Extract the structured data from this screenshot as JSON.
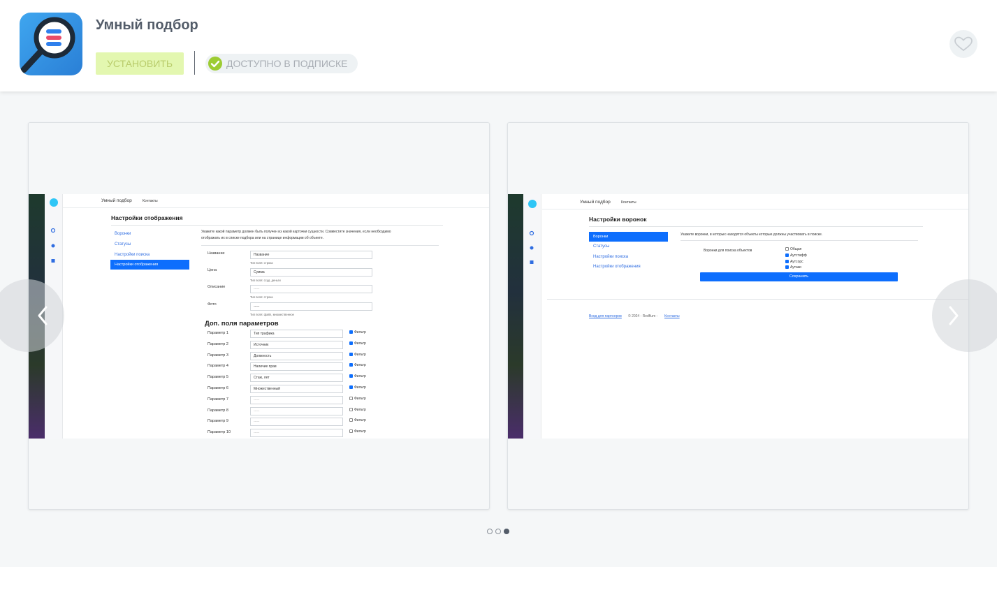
{
  "app": {
    "title": "Умный подбор",
    "install_label": "УСТАНОВИТЬ",
    "subscription_label": "ДОСТУПНО В ПОДПИСКЕ"
  },
  "slide1": {
    "topbar": {
      "brand": "Умный подбор",
      "link": "Контакты"
    },
    "page_title": "Настройки отображения",
    "nav": [
      "Воронки",
      "Статусы",
      "Настройки поиска",
      "Настройки отображения"
    ],
    "hint_line1": "Укажите какой параметр должен быть получен из какой карточки сущности. Совместите значения, если необходимо",
    "hint_line2": "отображать их в списке подбора или на странице информации об объекте.",
    "fields": [
      {
        "label": "Название",
        "value": "Название",
        "note": "Тип поля: строка"
      },
      {
        "label": "Цена",
        "value": "Сумма",
        "note": "Тип поля: ссуд. деньги"
      },
      {
        "label": "Описание",
        "value": "-----",
        "note": "Тип поля: строка"
      },
      {
        "label": "Фото",
        "value": "-----",
        "note": "Тип поля: файл, множественное"
      }
    ],
    "extra_title": "Доп. поля параметров",
    "filter_label": "Фильтр",
    "params": [
      {
        "label": "Параметр 1",
        "value": "Тип трафика"
      },
      {
        "label": "Параметр 2",
        "value": "Источник"
      },
      {
        "label": "Параметр 3",
        "value": "Должность"
      },
      {
        "label": "Параметр 4",
        "value": "Наличие прав"
      },
      {
        "label": "Параметр 5",
        "value": "Стаж, лет"
      },
      {
        "label": "Параметр 6",
        "value": "Множественный"
      },
      {
        "label": "Параметр 7",
        "value": "-----"
      },
      {
        "label": "Параметр 8",
        "value": "-----"
      },
      {
        "label": "Параметр 9",
        "value": "-----"
      },
      {
        "label": "Параметр 10",
        "value": "-----"
      }
    ]
  },
  "slide2": {
    "topbar": {
      "brand": "Умный подбор",
      "link": "Контакты"
    },
    "page_title": "Настройки воронок",
    "nav": [
      "Воронки",
      "Статусы",
      "Настройки поиска",
      "Настройки отображения"
    ],
    "hint": "Укажите воронки, в которых находятся объекты которые должны участвовать в поиске.",
    "funnels_label": "Воронки для поиска объектов",
    "funnels": [
      "Общая",
      "Аутстафф",
      "Аутсорс",
      "Аутаки"
    ],
    "save_label": "Сохранить",
    "footer_link1": "Вход для партнеров",
    "footer_mid": "© 2024 - Redflum -",
    "footer_link2": "Контакты"
  }
}
